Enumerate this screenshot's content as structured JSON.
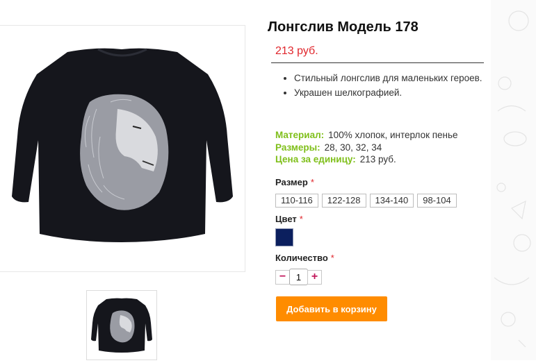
{
  "product": {
    "title": "Лонгслив Модель 178",
    "price": "213 руб.",
    "description": [
      "Стильный лонгслив для маленьких героев.",
      "Украшен шелкографией."
    ],
    "properties": [
      {
        "key": "Материал:",
        "value": "100% хлопок, интерлок пенье"
      },
      {
        "key": "Размеры:",
        "value": "28, 30, 32, 34"
      },
      {
        "key": "Цена за единицу:",
        "value": "213 руб."
      }
    ],
    "image_icon": "longsleeve-lion-print",
    "image_thumb_icon": "longsleeve-lion-print-thumb"
  },
  "options": {
    "size_label": "Размер",
    "sizes": [
      "110-116",
      "122-128",
      "134-140",
      "98-104"
    ],
    "color_label": "Цвет",
    "color_value": "#0b1f5e",
    "quantity_label": "Количество",
    "quantity_value": "1",
    "minus": "−",
    "plus": "+",
    "required_mark": "*"
  },
  "actions": {
    "add_to_cart": "Добавить в корзину"
  },
  "colors": {
    "price": "#e0262c",
    "property_key": "#7fbf1a",
    "cart_button": "#ff8c00",
    "shirt": "#15161c"
  }
}
